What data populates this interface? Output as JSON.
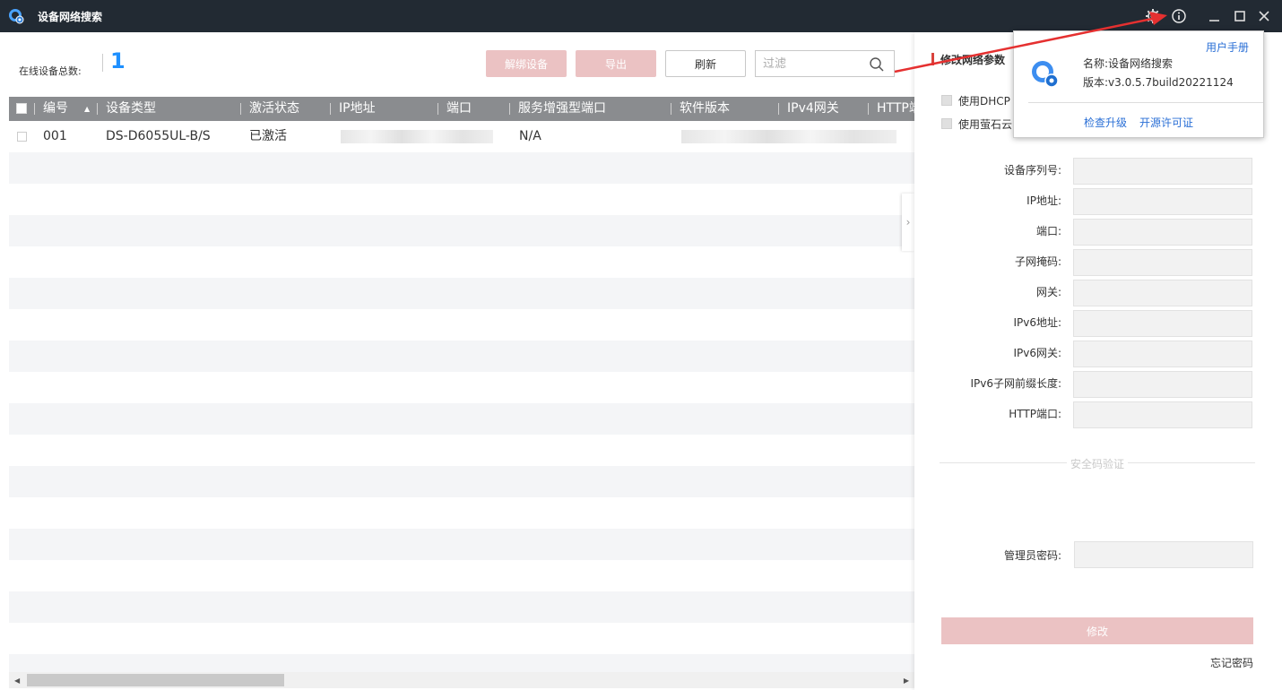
{
  "app": {
    "title": "设备网络搜索"
  },
  "titlebar": {
    "icons": [
      "settings-gear-icon",
      "info-icon",
      "minimize-icon",
      "maximize-icon",
      "close-icon"
    ]
  },
  "toolbar": {
    "online_label": "在线设备总数:",
    "online_count": "1",
    "unbind_label": "解绑设备",
    "export_label": "导出",
    "refresh_label": "刷新",
    "filter_placeholder": "过滤"
  },
  "table": {
    "columns": [
      "编号",
      "设备类型",
      "激活状态",
      "IP地址",
      "端口",
      "服务增强型端口",
      "软件版本",
      "IPv4网关",
      "HTTP端口"
    ],
    "rows": [
      {
        "id": "001",
        "type": "DS-D6055UL-B/S",
        "status": "已激活",
        "ip": "",
        "port": "",
        "enhanced_port": "N/A",
        "software": "",
        "gateway": "",
        "http": ""
      }
    ]
  },
  "panel": {
    "title": "修改网络参数",
    "use_dhcp": "使用DHCP",
    "use_ezviz": "使用萤石云",
    "fields": [
      "设备序列号:",
      "IP地址:",
      "端口:",
      "子网掩码:",
      "网关:",
      "IPv6地址:",
      "IPv6网关:",
      "IPv6子网前缀长度:",
      "HTTP端口:"
    ],
    "security_section": "安全码验证",
    "admin_password_label": "管理员密码:",
    "modify_label": "修改",
    "forgot_label": "忘记密码"
  },
  "about_popup": {
    "manual_link": "用户手册",
    "name_line": "名称:设备网络搜索",
    "version_line": "版本:v3.0.5.7build20221124",
    "check_update": "检查升级",
    "open_source_license": "开源许可证"
  },
  "colors": {
    "titlebar_bg": "#222a33",
    "table_header_bg": "#8a8c8f",
    "disabled_button": "#ebc2c3",
    "accent_blue": "#1e90ff",
    "link_blue": "#2a6fd6",
    "annotation_arrow": "#e53030"
  }
}
